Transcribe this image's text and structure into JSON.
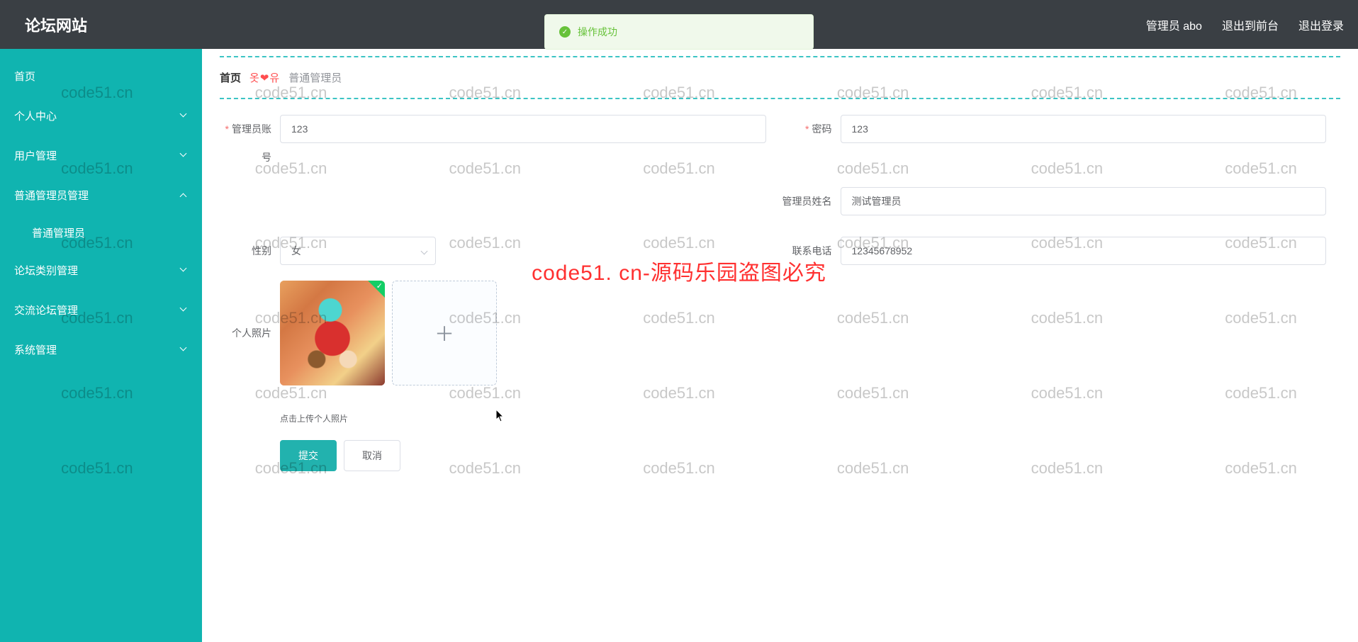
{
  "header": {
    "title": "论坛网站",
    "admin_label": "管理员 abo",
    "link_frontend": "退出到前台",
    "link_logout": "退出登录"
  },
  "toast": {
    "message": "操作成功"
  },
  "sidebar": {
    "home": "首页",
    "personal": "个人中心",
    "user_mgmt": "用户管理",
    "admin_mgmt": "普通管理员管理",
    "admin_sub": "普通管理员",
    "forum_category": "论坛类别管理",
    "forum_exchange": "交流论坛管理",
    "system": "系统管理"
  },
  "breadcrumb": {
    "home": "首页",
    "sep": "옷❤유",
    "current": "普通管理员"
  },
  "form": {
    "labels": {
      "account": "管理员账号",
      "password": "密码",
      "name": "管理员姓名",
      "gender": "性别",
      "phone": "联系电话",
      "photo": "个人照片"
    },
    "values": {
      "account": "123",
      "password": "123",
      "name": "测试管理员",
      "gender": "女",
      "phone": "12345678952"
    },
    "upload_tip": "点击上传个人照片",
    "submit": "提交",
    "cancel": "取消"
  },
  "watermark": {
    "text": "code51.cn",
    "banner": "code51. cn-源码乐园盗图必究"
  }
}
